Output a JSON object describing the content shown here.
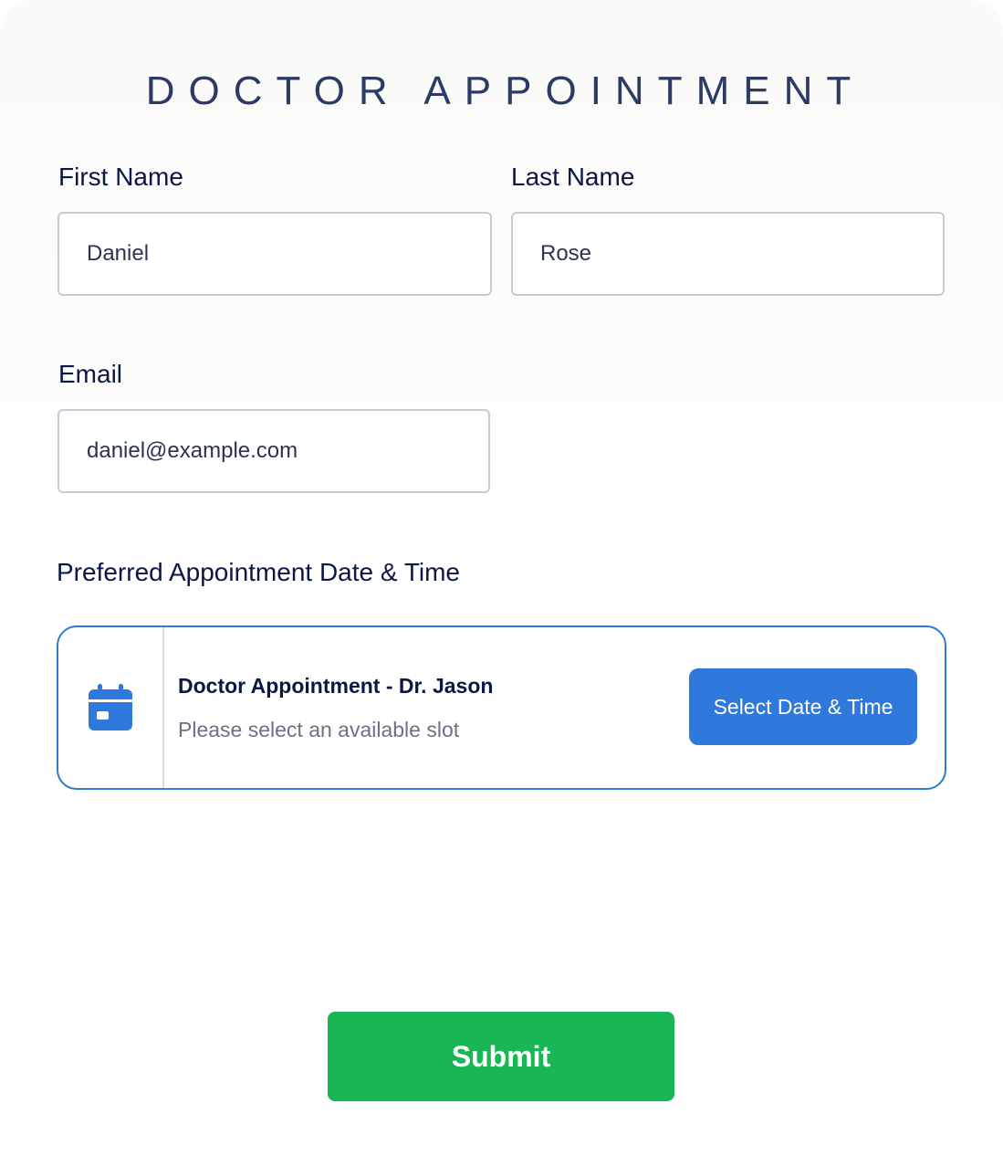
{
  "form": {
    "title": "DOCTOR APPOINTMENT",
    "first_name": {
      "label": "First Name",
      "value": "Daniel"
    },
    "last_name": {
      "label": "Last Name",
      "value": "Rose"
    },
    "email": {
      "label": "Email",
      "value": "daniel@example.com"
    },
    "appointment": {
      "label": "Preferred Appointment Date & Time",
      "icon": "calendar-icon",
      "title": "Doctor Appointment - Dr. Jason",
      "subtitle": "Please select an available slot",
      "button_label": "Select Date & Time"
    },
    "submit_label": "Submit"
  },
  "colors": {
    "title": "#2c3a66",
    "label": "#0b1744",
    "accent_blue": "#2f78dc",
    "submit_green": "#18b655",
    "field_border": "#c8cad6"
  }
}
